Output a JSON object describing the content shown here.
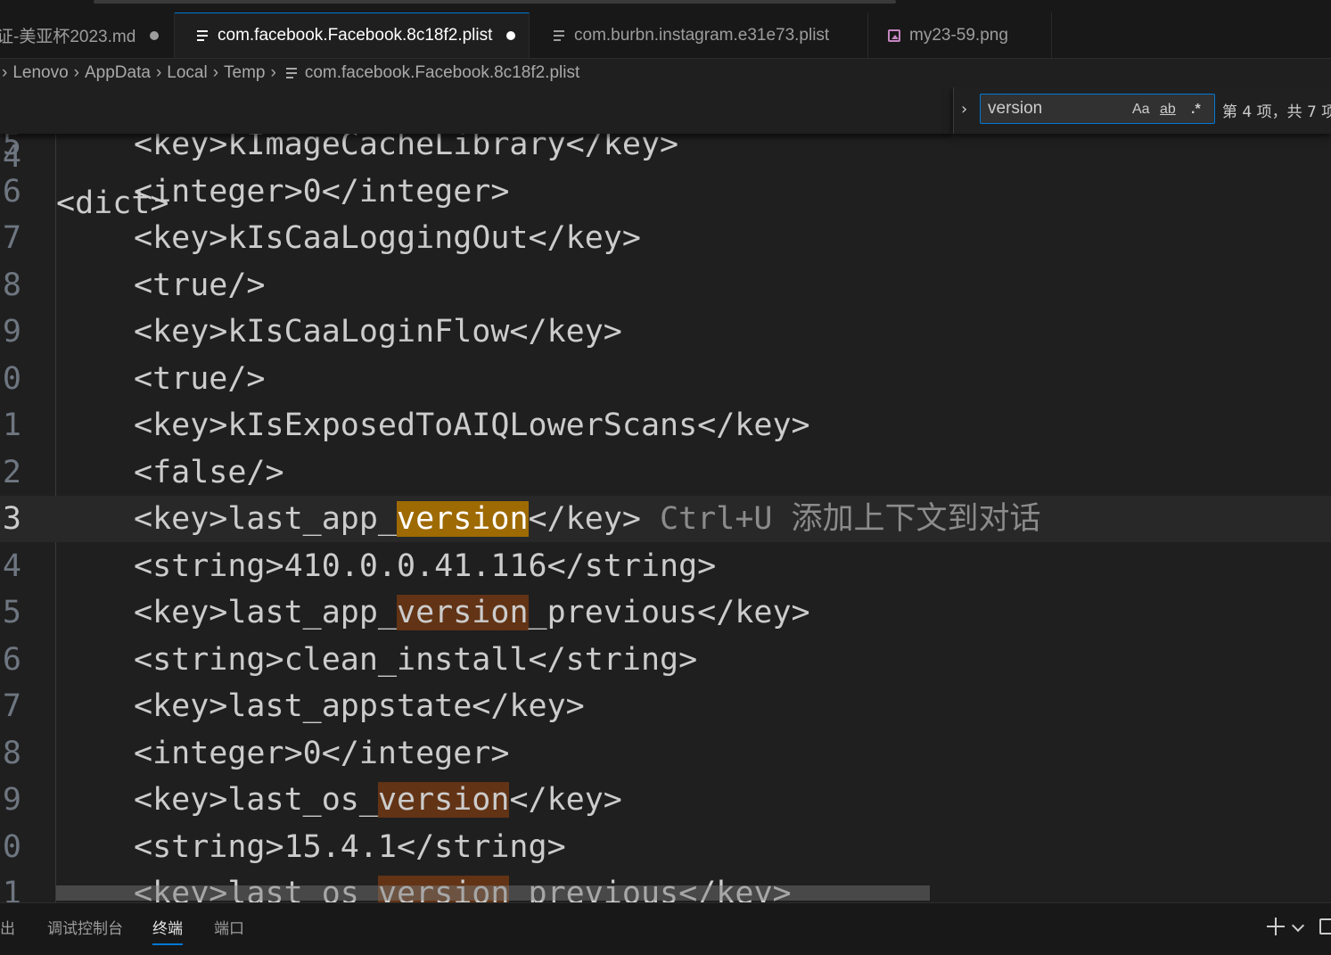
{
  "tabs": [
    {
      "label": "证-美亚杯2023.md",
      "icon": "markdown-icon",
      "dirty": true,
      "active": false
    },
    {
      "label": "com.facebook.Facebook.8c18f2.plist",
      "icon": "file-lines-icon",
      "dirty": true,
      "active": true
    },
    {
      "label": "com.burbn.instagram.e31e73.plist",
      "icon": "file-lines-icon",
      "dirty": false,
      "active": false
    },
    {
      "label": "my23-59.png",
      "icon": "image-icon",
      "dirty": false,
      "active": false
    }
  ],
  "breadcrumb": {
    "items": [
      "Lenovo",
      "AppData",
      "Local",
      "Temp"
    ],
    "file": "com.facebook.Facebook.8c18f2.plist"
  },
  "sticky_line": {
    "num": "4",
    "text": "<dict>"
  },
  "find": {
    "query": "version",
    "opt_case": "Aa",
    "opt_word": "ab",
    "opt_regex": ".*",
    "count": "第 4 项，共 7 项"
  },
  "lines": [
    {
      "num": "5",
      "pre": "<key>kImageCacheLibrary</key>"
    },
    {
      "num": "6",
      "pre": "<integer>0</integer>"
    },
    {
      "num": "7",
      "pre": "<key>kIsCaaLoggingOut</key>"
    },
    {
      "num": "8",
      "pre": "<true/>"
    },
    {
      "num": "9",
      "pre": "<key>kIsCaaLoginFlow</key>"
    },
    {
      "num": "0",
      "pre": "<true/>"
    },
    {
      "num": "1",
      "pre": "<key>kIsExposedToAIQLowerScans</key>"
    },
    {
      "num": "2",
      "pre": "<false/>"
    },
    {
      "num": "3",
      "pre": "<key>last_app_",
      "match": "version",
      "post": "</key>",
      "ghost": " Ctrl+U 添加上下文到对话",
      "current": true
    },
    {
      "num": "4",
      "pre": "<string>410.0.0.41.116</string>"
    },
    {
      "num": "5",
      "pre": "<key>last_app_",
      "match": "version",
      "post": "_previous</key>"
    },
    {
      "num": "6",
      "pre": "<string>clean_install</string>"
    },
    {
      "num": "7",
      "pre": "<key>last_appstate</key>"
    },
    {
      "num": "8",
      "pre": "<integer>0</integer>"
    },
    {
      "num": "9",
      "pre": "<key>last_os_",
      "match": "version",
      "post": "</key>"
    },
    {
      "num": "0",
      "pre": "<string>15.4.1</string>"
    },
    {
      "num": "1",
      "pre": "<key>last_os_",
      "match": "version",
      "post": "_previous</key>"
    }
  ],
  "panel_tabs": [
    {
      "label": "出",
      "active": false
    },
    {
      "label": "调试控制台",
      "active": false
    },
    {
      "label": "终端",
      "active": true
    },
    {
      "label": "端口",
      "active": false
    }
  ],
  "colors": {
    "active_match": "#9e6a03",
    "other_match": "#623315",
    "accent": "#0078d4"
  }
}
